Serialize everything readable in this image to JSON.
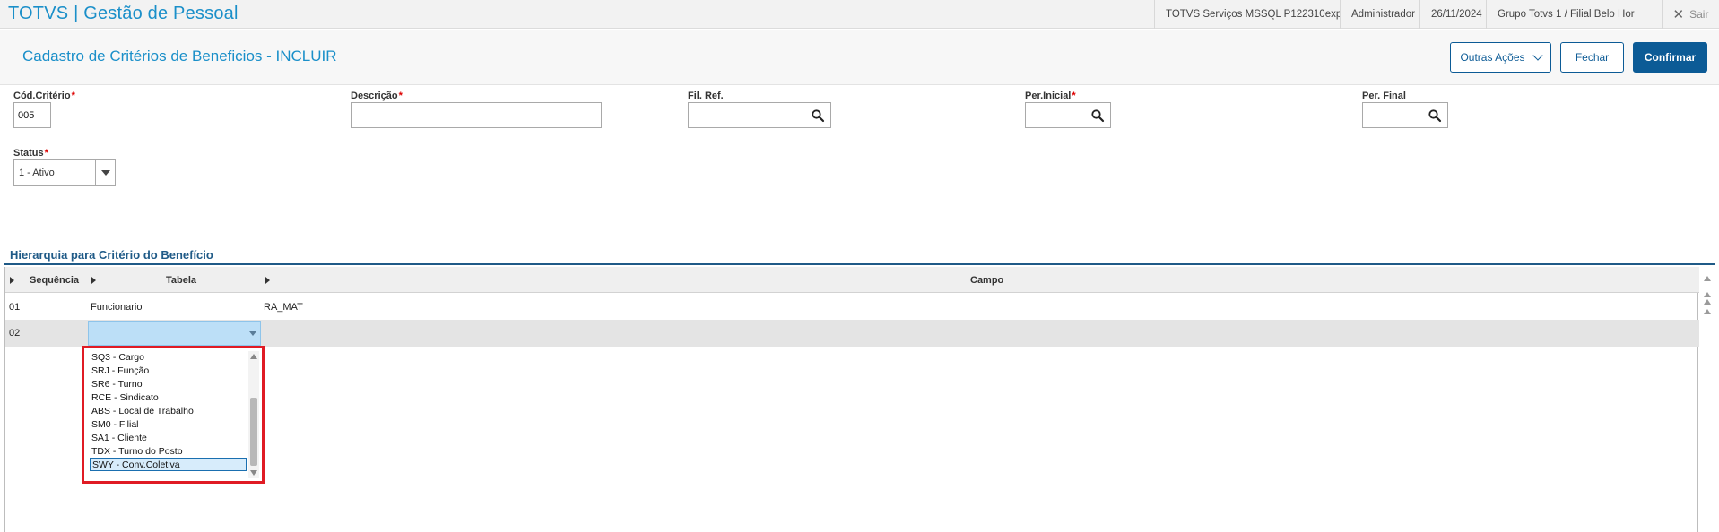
{
  "app": {
    "title": "TOTVS | Gestão de Pessoal"
  },
  "topbar": {
    "environment": "TOTVS Serviços MSSQL P122310exp",
    "user": "Administrador",
    "date": "26/11/2024",
    "branch": "Grupo Totvs 1 / Filial Belo Hor",
    "exit_label": "Sair"
  },
  "header": {
    "page_title": "Cadastro de Critérios de Beneficios - INCLUIR",
    "other_actions_label": "Outras Ações",
    "close_label": "Fechar",
    "confirm_label": "Confirmar"
  },
  "form": {
    "cod_criterio": {
      "label": "Cód.Critério",
      "value": "005",
      "required": true
    },
    "descricao": {
      "label": "Descrição",
      "value": "",
      "required": true
    },
    "fil_ref": {
      "label": "Fil. Ref.",
      "value": ""
    },
    "per_inicial": {
      "label": "Per.Inicial",
      "value": "",
      "required": true
    },
    "per_final": {
      "label": "Per. Final",
      "value": ""
    },
    "status": {
      "label": "Status",
      "value": "1 - Ativo",
      "required": true
    },
    "required_mark": "*"
  },
  "section": {
    "title": "Hierarquia para Critério do Benefício"
  },
  "grid": {
    "columns": [
      "Sequência",
      "Tabela",
      "Campo"
    ],
    "rows": [
      {
        "sequencia": "01",
        "tabela": "Funcionario",
        "campo": "RA_MAT"
      },
      {
        "sequencia": "02",
        "tabela": "",
        "campo": ""
      }
    ]
  },
  "dropdown": {
    "items": [
      "SQ3 - Cargo",
      "SRJ - Função",
      "SR6 - Turno",
      "RCE - Sindicato",
      "ABS - Local de Trabalho",
      "SM0 - Filial",
      "SA1 - Cliente",
      "TDX - Turno do Posto",
      "SWY - Conv.Coletiva"
    ],
    "selected": "SWY - Conv.Coletiva"
  },
  "colors": {
    "brand": "#1a8fc9",
    "primary": "#0c5b96",
    "section": "#1f5a87",
    "highlight_border": "#e01b24",
    "required": "#dd0000"
  },
  "icons": [
    "search-icon",
    "chevron-down-icon",
    "close-icon",
    "caret-down-icon",
    "caret-right-icon",
    "scroll-up-icon",
    "scroll-down-icon"
  ]
}
